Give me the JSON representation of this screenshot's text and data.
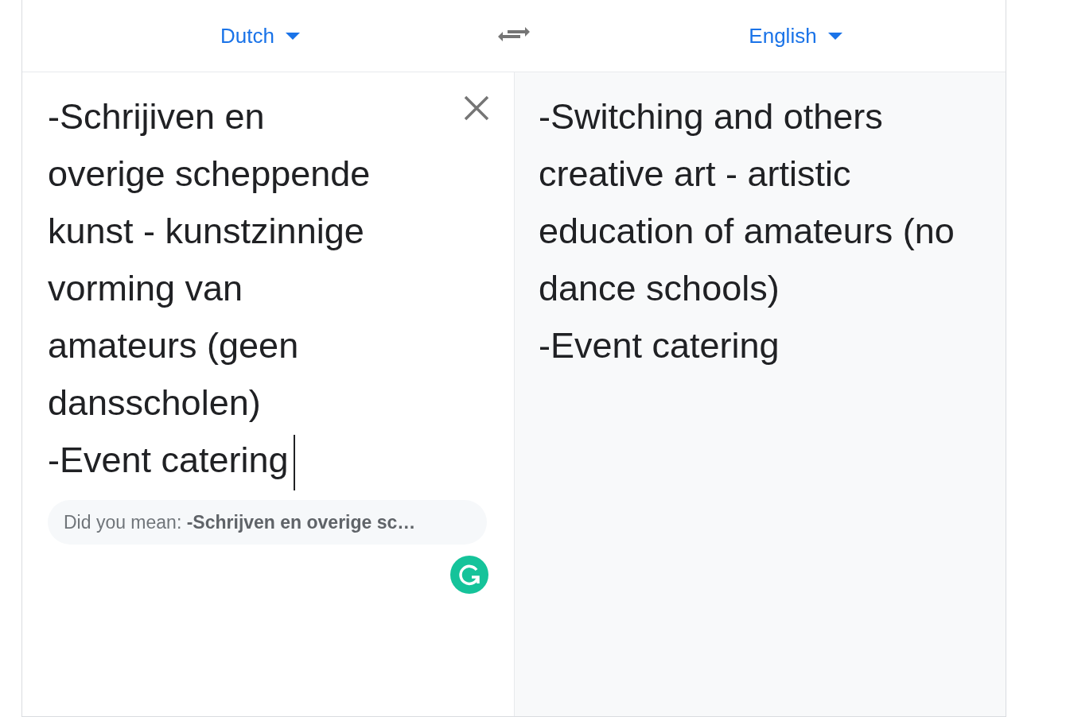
{
  "languages": {
    "source": "Dutch",
    "target": "English"
  },
  "source": {
    "text": "-Schrijiven en overige scheppende kunst - kunstzinnige vorming van amateurs (geen dansscholen)\n-Event catering",
    "cursor_visible": true,
    "suggestion": "Did you mean: **-Schrijven en overige sc…**"
  },
  "target": {
    "text": "-Switching and others creative art - artistic education of amateurs (no dance schools)\n-Event catering"
  }
}
